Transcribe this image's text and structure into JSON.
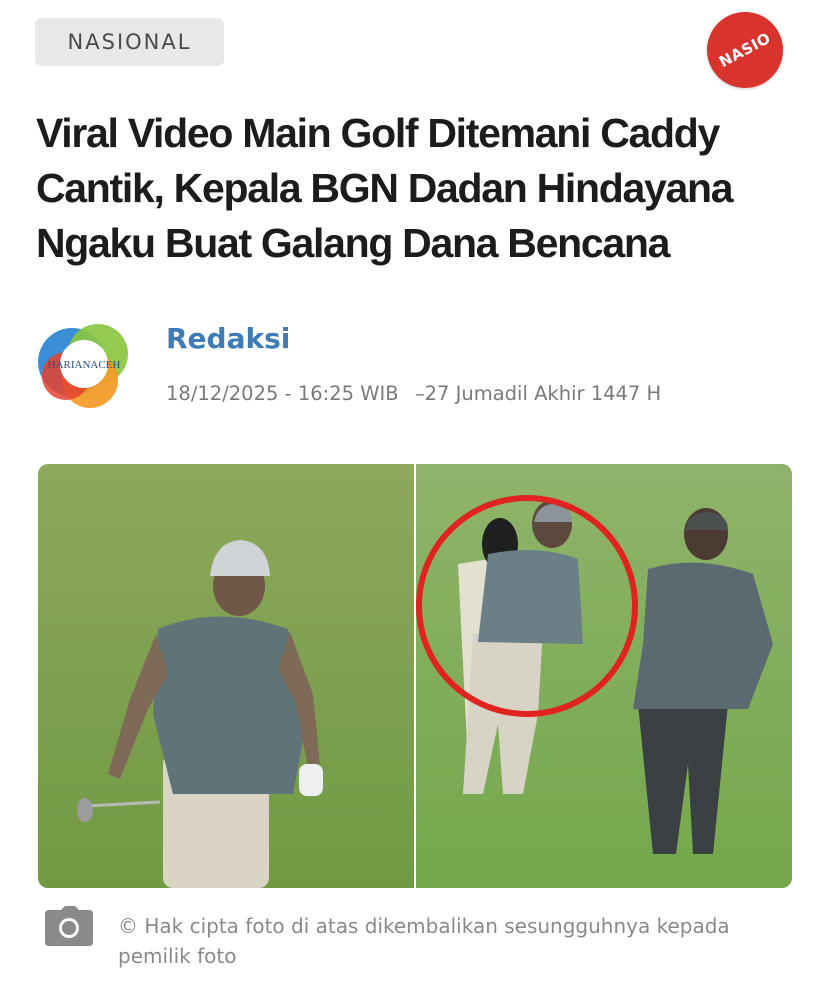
{
  "article": {
    "category": "NASIONAL",
    "badge_text": "NASIO",
    "headline": "Viral Video Main Golf Ditemani Caddy Cantik, Kepala BGN Dadan Hindayana Ngaku Buat Galang Dana Bencana",
    "author": {
      "name": "Redaksi",
      "logo_text": "HARIANACEH"
    },
    "date": "18/12/2025 - 16:25 WIB",
    "hijri_date": "27 Jumadil Akhir 1447 H",
    "photo": {
      "caption": "© Hak cipta foto di atas dikembalikan sesungguhnya kepada pemilik foto"
    }
  },
  "colors": {
    "category_bg": "#e8e8e8",
    "badge": "#d9332d",
    "author": "#3f7bb6",
    "meta": "#7a7a7a",
    "caption": "#8a8a8a",
    "highlight_circle": "#e0231f"
  },
  "icons": {
    "caption": "camera-icon"
  }
}
